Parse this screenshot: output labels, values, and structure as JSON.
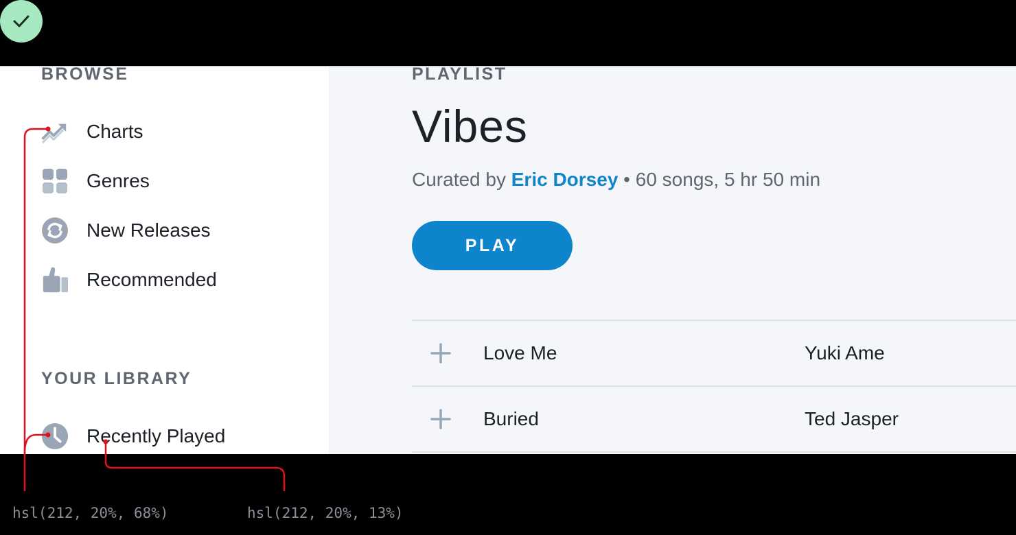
{
  "colors": {
    "accent": "#0d84cb",
    "icon_gray": "#9aa6b6",
    "text_dark": "#1c2028",
    "annotation_red": "#e0101e",
    "check_green": "#a6e9c1"
  },
  "badge": {
    "icon": "check-icon"
  },
  "sidebar": {
    "browse_title": "BROWSE",
    "browse_items": [
      {
        "label": "Charts",
        "icon": "trending-up-icon"
      },
      {
        "label": "Genres",
        "icon": "grid-icon"
      },
      {
        "label": "New Releases",
        "icon": "refresh-icon"
      },
      {
        "label": "Recommended",
        "icon": "thumbs-up-icon"
      }
    ],
    "library_title": "YOUR LIBRARY",
    "library_items": [
      {
        "label": "Recently Played",
        "icon": "clock-icon"
      }
    ]
  },
  "main": {
    "section_label": "PLAYLIST",
    "title": "Vibes",
    "meta_prefix": "Curated by",
    "curator": "Eric Dorsey",
    "meta_suffix": "• 60 songs, 5 hr 50 min",
    "play_label": "PLAY",
    "tracks": [
      {
        "name": "Love Me",
        "artist": "Yuki Ame"
      },
      {
        "name": "Buried",
        "artist": "Ted Jasper"
      }
    ]
  },
  "annotations": {
    "icon_color": "hsl(212, 20%, 68%)",
    "text_color": "hsl(212, 20%, 13%)"
  }
}
